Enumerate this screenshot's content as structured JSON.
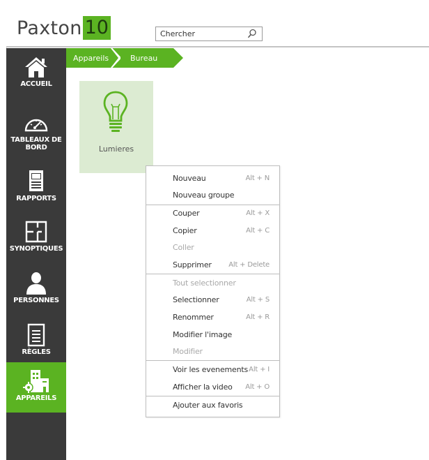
{
  "header": {
    "logo_text": "Paxton",
    "logo_number": "10",
    "search_placeholder": "Chercher",
    "search_value": "Chercher"
  },
  "sidebar": {
    "items": [
      {
        "label": "ACCUEIL",
        "icon": "home-icon"
      },
      {
        "label": "TABLEAUX DE BORD",
        "icon": "dashboard-gauge-icon"
      },
      {
        "label": "RAPPORTS",
        "icon": "report-icon"
      },
      {
        "label": "SYNOPTIQUES",
        "icon": "floorplan-icon"
      },
      {
        "label": "PERSONNES",
        "icon": "person-icon"
      },
      {
        "label": "RÈGLES",
        "icon": "rules-list-icon"
      },
      {
        "label": "APPAREILS",
        "icon": "devices-building-icon",
        "active": true
      }
    ],
    "colors": {
      "background": "#3a3a3a",
      "active": "#5bb322"
    }
  },
  "breadcrumb": {
    "items": [
      "Appareils",
      "Bureau"
    ]
  },
  "tile": {
    "label": "Lumieres",
    "icon": "lightbulb-icon"
  },
  "context_menu": {
    "items": [
      {
        "label": "Nouveau",
        "shortcut": "Alt + N",
        "enabled": true
      },
      {
        "label": "Nouveau groupe",
        "shortcut": "",
        "enabled": true
      },
      {
        "label": "Couper",
        "shortcut": "Alt + X",
        "enabled": true
      },
      {
        "label": "Copier",
        "shortcut": "Alt + C",
        "enabled": true
      },
      {
        "label": "Coller",
        "shortcut": "",
        "enabled": false
      },
      {
        "label": "Supprimer",
        "shortcut": "Alt + Delete",
        "enabled": true
      },
      {
        "label": "Tout selectionner",
        "shortcut": "",
        "enabled": false
      },
      {
        "label": "Selectionner",
        "shortcut": "Alt + S",
        "enabled": true
      },
      {
        "label": "Renommer",
        "shortcut": "Alt + R",
        "enabled": true
      },
      {
        "label": "Modifier l'image",
        "shortcut": "",
        "enabled": true
      },
      {
        "label": "Modifier",
        "shortcut": "",
        "enabled": false
      },
      {
        "label": "Voir les evenements",
        "shortcut": "Alt + I",
        "enabled": true
      },
      {
        "label": "Afficher la video",
        "shortcut": "Alt + O",
        "enabled": true
      },
      {
        "label": "Ajouter aux favoris",
        "shortcut": "",
        "enabled": true
      }
    ]
  },
  "colors": {
    "accent": "#5bb322",
    "tile_background": "#dcebd2"
  }
}
